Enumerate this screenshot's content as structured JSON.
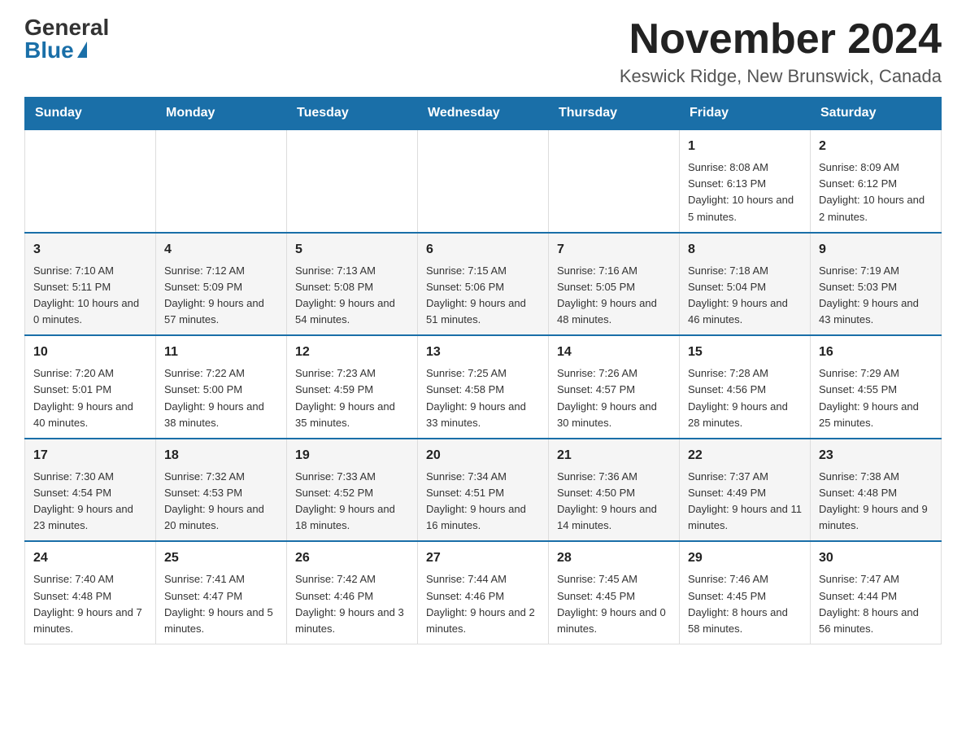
{
  "header": {
    "logo_general": "General",
    "logo_blue": "Blue",
    "month_title": "November 2024",
    "location": "Keswick Ridge, New Brunswick, Canada"
  },
  "days_of_week": [
    "Sunday",
    "Monday",
    "Tuesday",
    "Wednesday",
    "Thursday",
    "Friday",
    "Saturday"
  ],
  "weeks": [
    {
      "days": [
        {
          "num": "",
          "info": ""
        },
        {
          "num": "",
          "info": ""
        },
        {
          "num": "",
          "info": ""
        },
        {
          "num": "",
          "info": ""
        },
        {
          "num": "",
          "info": ""
        },
        {
          "num": "1",
          "info": "Sunrise: 8:08 AM\nSunset: 6:13 PM\nDaylight: 10 hours and 5 minutes."
        },
        {
          "num": "2",
          "info": "Sunrise: 8:09 AM\nSunset: 6:12 PM\nDaylight: 10 hours and 2 minutes."
        }
      ]
    },
    {
      "days": [
        {
          "num": "3",
          "info": "Sunrise: 7:10 AM\nSunset: 5:11 PM\nDaylight: 10 hours and 0 minutes."
        },
        {
          "num": "4",
          "info": "Sunrise: 7:12 AM\nSunset: 5:09 PM\nDaylight: 9 hours and 57 minutes."
        },
        {
          "num": "5",
          "info": "Sunrise: 7:13 AM\nSunset: 5:08 PM\nDaylight: 9 hours and 54 minutes."
        },
        {
          "num": "6",
          "info": "Sunrise: 7:15 AM\nSunset: 5:06 PM\nDaylight: 9 hours and 51 minutes."
        },
        {
          "num": "7",
          "info": "Sunrise: 7:16 AM\nSunset: 5:05 PM\nDaylight: 9 hours and 48 minutes."
        },
        {
          "num": "8",
          "info": "Sunrise: 7:18 AM\nSunset: 5:04 PM\nDaylight: 9 hours and 46 minutes."
        },
        {
          "num": "9",
          "info": "Sunrise: 7:19 AM\nSunset: 5:03 PM\nDaylight: 9 hours and 43 minutes."
        }
      ]
    },
    {
      "days": [
        {
          "num": "10",
          "info": "Sunrise: 7:20 AM\nSunset: 5:01 PM\nDaylight: 9 hours and 40 minutes."
        },
        {
          "num": "11",
          "info": "Sunrise: 7:22 AM\nSunset: 5:00 PM\nDaylight: 9 hours and 38 minutes."
        },
        {
          "num": "12",
          "info": "Sunrise: 7:23 AM\nSunset: 4:59 PM\nDaylight: 9 hours and 35 minutes."
        },
        {
          "num": "13",
          "info": "Sunrise: 7:25 AM\nSunset: 4:58 PM\nDaylight: 9 hours and 33 minutes."
        },
        {
          "num": "14",
          "info": "Sunrise: 7:26 AM\nSunset: 4:57 PM\nDaylight: 9 hours and 30 minutes."
        },
        {
          "num": "15",
          "info": "Sunrise: 7:28 AM\nSunset: 4:56 PM\nDaylight: 9 hours and 28 minutes."
        },
        {
          "num": "16",
          "info": "Sunrise: 7:29 AM\nSunset: 4:55 PM\nDaylight: 9 hours and 25 minutes."
        }
      ]
    },
    {
      "days": [
        {
          "num": "17",
          "info": "Sunrise: 7:30 AM\nSunset: 4:54 PM\nDaylight: 9 hours and 23 minutes."
        },
        {
          "num": "18",
          "info": "Sunrise: 7:32 AM\nSunset: 4:53 PM\nDaylight: 9 hours and 20 minutes."
        },
        {
          "num": "19",
          "info": "Sunrise: 7:33 AM\nSunset: 4:52 PM\nDaylight: 9 hours and 18 minutes."
        },
        {
          "num": "20",
          "info": "Sunrise: 7:34 AM\nSunset: 4:51 PM\nDaylight: 9 hours and 16 minutes."
        },
        {
          "num": "21",
          "info": "Sunrise: 7:36 AM\nSunset: 4:50 PM\nDaylight: 9 hours and 14 minutes."
        },
        {
          "num": "22",
          "info": "Sunrise: 7:37 AM\nSunset: 4:49 PM\nDaylight: 9 hours and 11 minutes."
        },
        {
          "num": "23",
          "info": "Sunrise: 7:38 AM\nSunset: 4:48 PM\nDaylight: 9 hours and 9 minutes."
        }
      ]
    },
    {
      "days": [
        {
          "num": "24",
          "info": "Sunrise: 7:40 AM\nSunset: 4:48 PM\nDaylight: 9 hours and 7 minutes."
        },
        {
          "num": "25",
          "info": "Sunrise: 7:41 AM\nSunset: 4:47 PM\nDaylight: 9 hours and 5 minutes."
        },
        {
          "num": "26",
          "info": "Sunrise: 7:42 AM\nSunset: 4:46 PM\nDaylight: 9 hours and 3 minutes."
        },
        {
          "num": "27",
          "info": "Sunrise: 7:44 AM\nSunset: 4:46 PM\nDaylight: 9 hours and 2 minutes."
        },
        {
          "num": "28",
          "info": "Sunrise: 7:45 AM\nSunset: 4:45 PM\nDaylight: 9 hours and 0 minutes."
        },
        {
          "num": "29",
          "info": "Sunrise: 7:46 AM\nSunset: 4:45 PM\nDaylight: 8 hours and 58 minutes."
        },
        {
          "num": "30",
          "info": "Sunrise: 7:47 AM\nSunset: 4:44 PM\nDaylight: 8 hours and 56 minutes."
        }
      ]
    }
  ]
}
